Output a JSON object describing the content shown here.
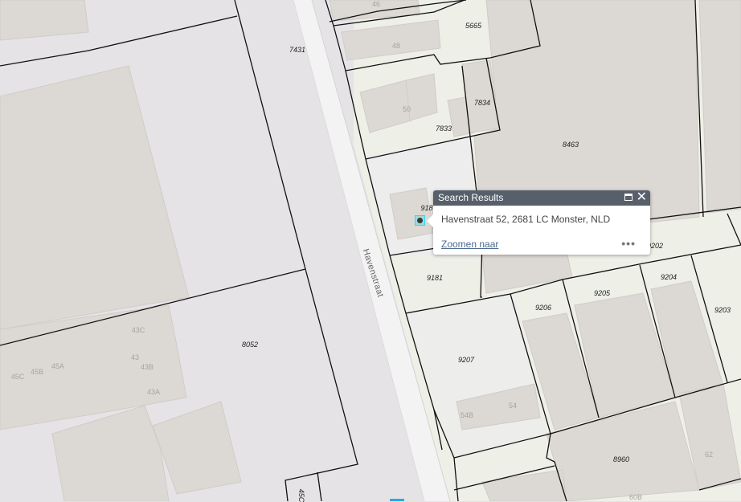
{
  "map": {
    "street_name": "Havenstraat",
    "parcel_labels": [
      "7431",
      "5665",
      "7834",
      "7833",
      "8463",
      "918",
      "9181",
      "9202",
      "9204",
      "9205",
      "9206",
      "9203",
      "9207",
      "8052",
      "8960",
      "45C"
    ],
    "house_numbers": [
      "46",
      "48",
      "50",
      "43C",
      "43",
      "43B",
      "45A",
      "45B",
      "45C",
      "43A",
      "54B",
      "54",
      "62",
      "60B"
    ]
  },
  "popup": {
    "title": "Search Results",
    "address": "Havenstraat 52, 2681 LC Monster, NLD",
    "zoom_link": "Zoomen naar",
    "more_label": "•••",
    "close_label": "✕"
  }
}
